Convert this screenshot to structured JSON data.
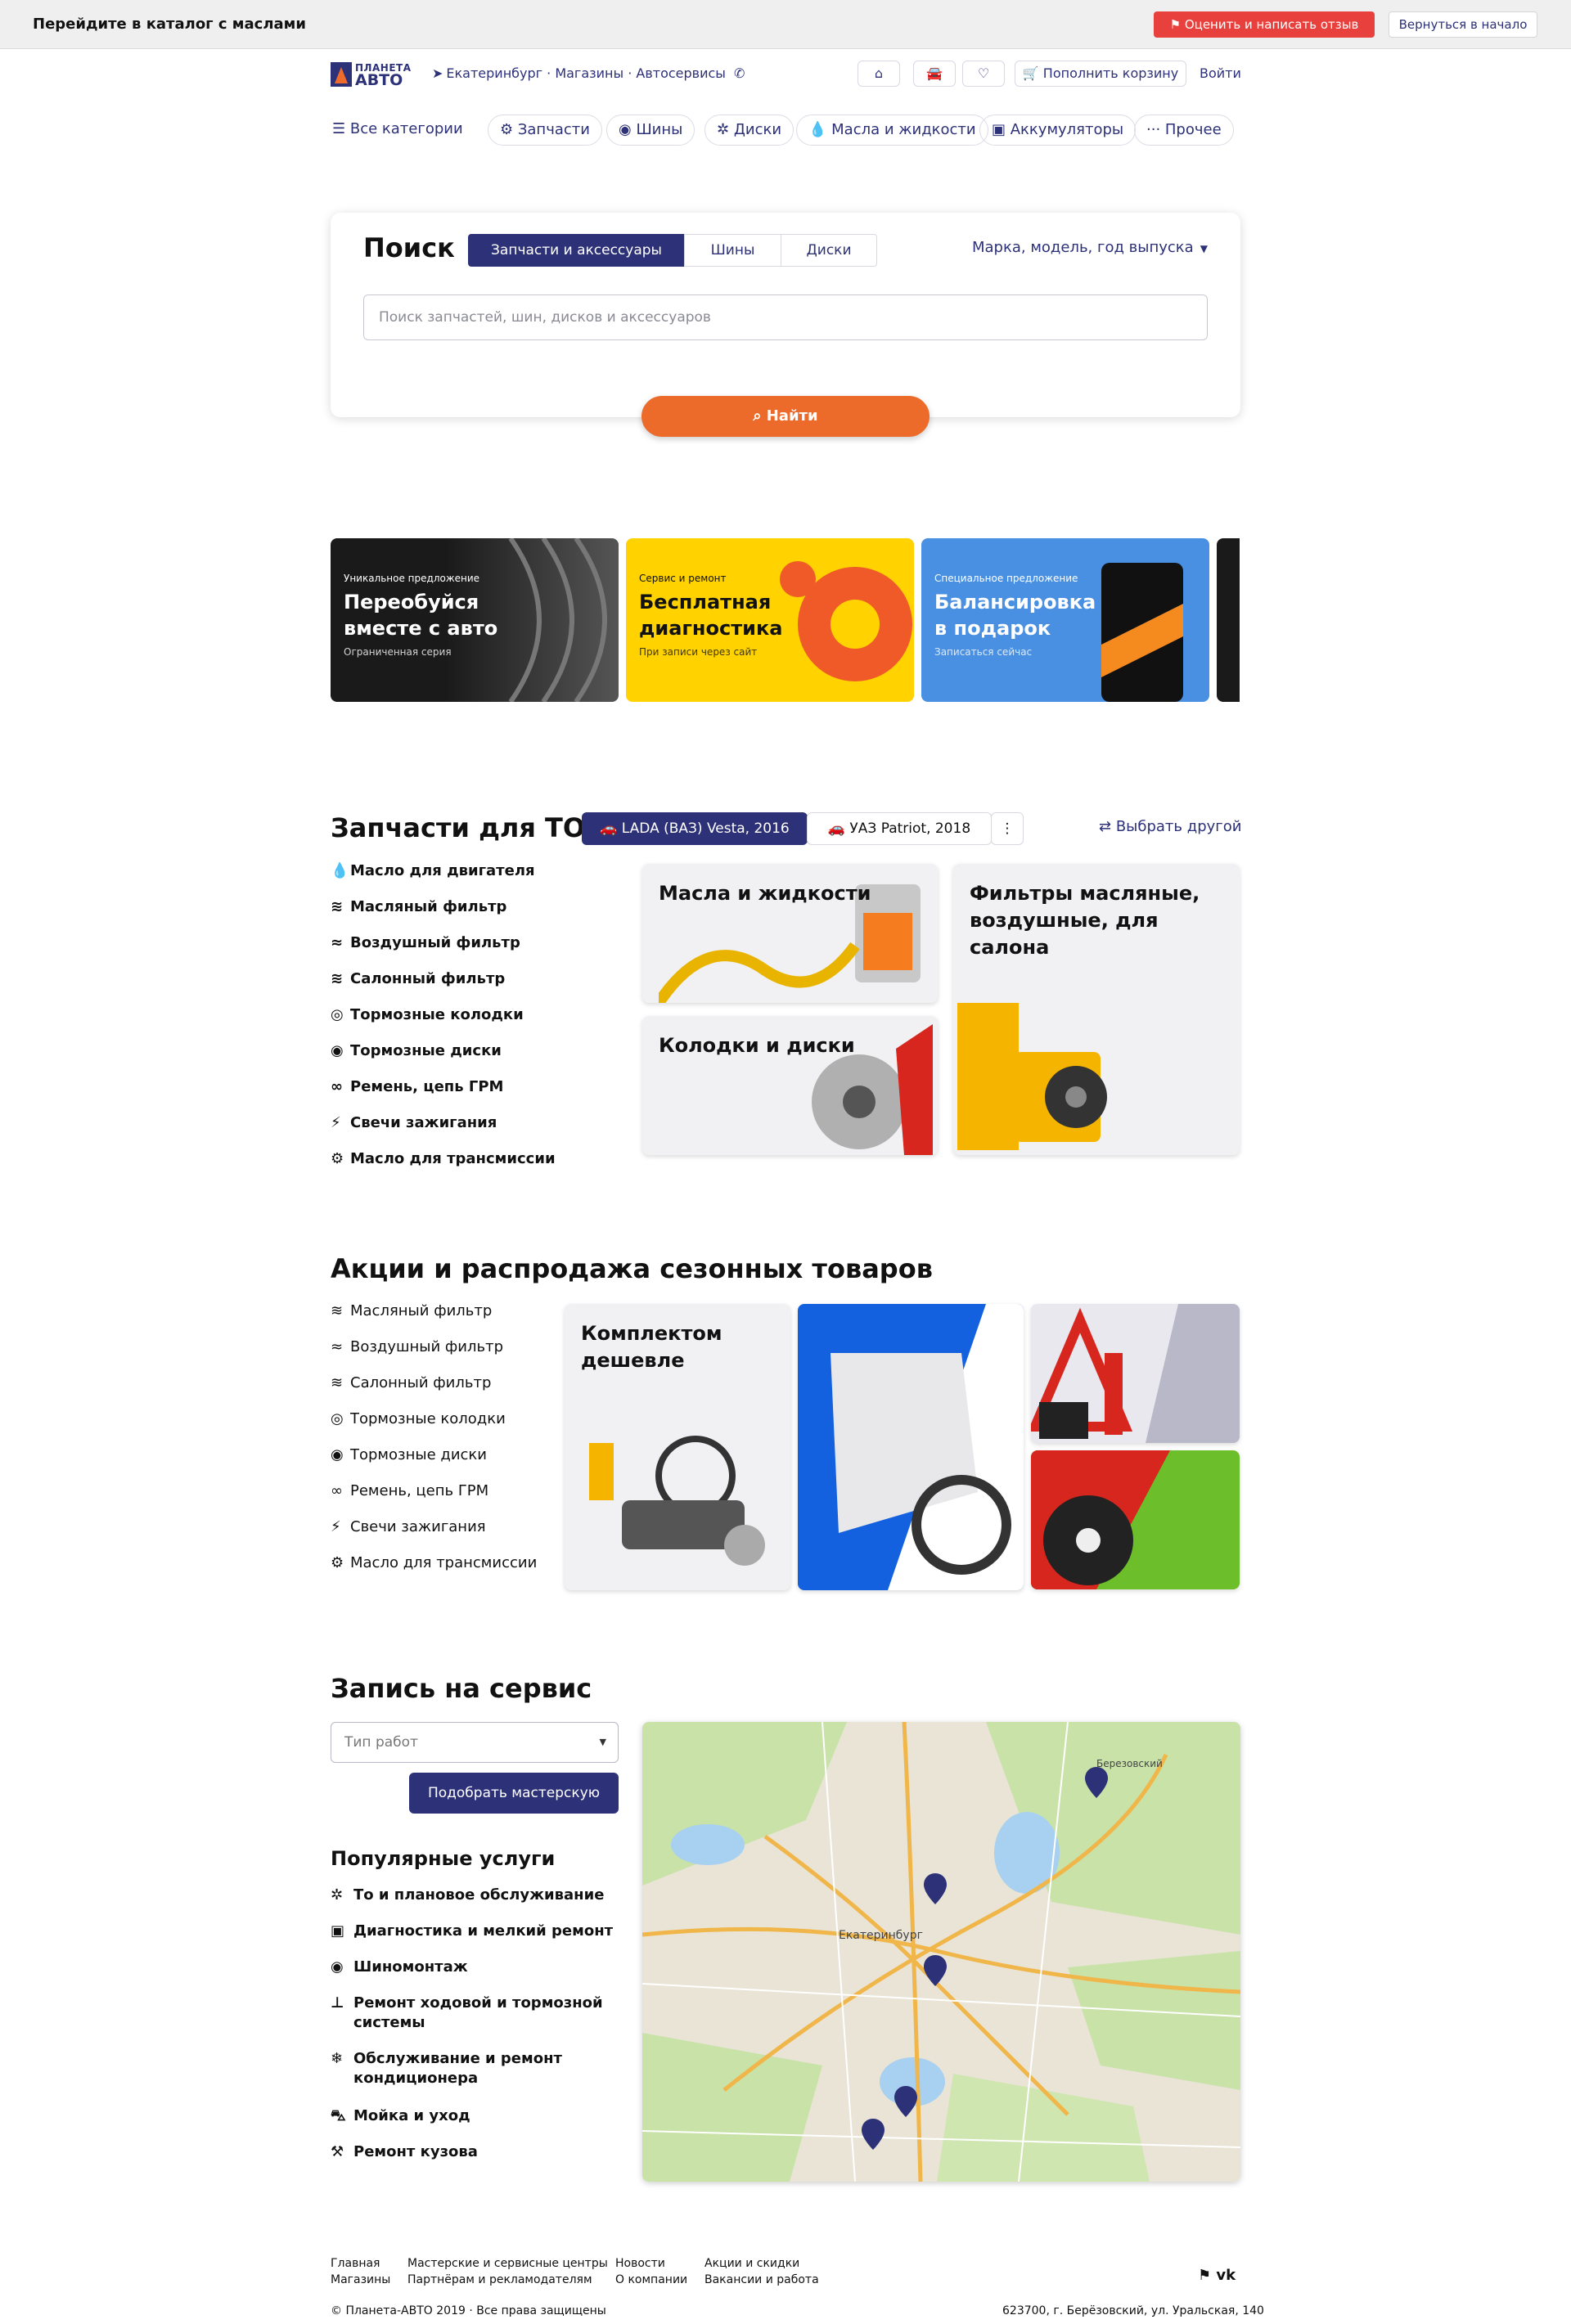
{
  "topbar": {
    "title": "Перейдите в каталог с маслами",
    "review": "Оценить и написать отзыв",
    "back": "Вернуться в начало"
  },
  "header": {
    "logo_top": "ПЛАНЕТА",
    "logo_bottom": "АВТО",
    "links": "Екатеринбург · Магазины · Автосервисы",
    "cart": "Пополнить корзину",
    "login": "Войти"
  },
  "categories": {
    "all": "Все категории",
    "items": [
      "Запчасти",
      "Шины",
      "Диски",
      "Масла и жидкости",
      "Аккумуляторы",
      "Прочее"
    ]
  },
  "search": {
    "title": "Поиск",
    "tabs": [
      "Запчасти и аксессуары",
      "Шины",
      "Диски"
    ],
    "vehicle": "Марка, модель, год выпуска",
    "placeholder": "Поиск запчастей, шин, дисков и аксессуаров",
    "button": "Найти"
  },
  "banners": [
    {
      "small": "Уникальное предложение",
      "big": "Переобуйся вместе с авто",
      "foot": "Ограниченная серия",
      "bg": "#2a2a2a"
    },
    {
      "small": "Сервис и ремонт",
      "big": "Бесплатная диагностика",
      "foot": "При записи через сайт",
      "bg": "#ffd200"
    },
    {
      "small": "Специальное предложение",
      "big": "Балансировка в подарок",
      "foot": "Записаться сейчас",
      "bg": "#4a90e2"
    }
  ],
  "to": {
    "title": "Запчасти для ТО",
    "cars": [
      "LADA (ВАЗ) Vesta, 2016",
      "УАЗ Patriot, 2018"
    ],
    "other": "Выбрать другой",
    "list": [
      "Масло для двигателя",
      "Масляный фильтр",
      "Воздушный фильтр",
      "Салонный фильтр",
      "Тормозные колодки",
      "Тормозные диски",
      "Ремень, цепь ГРМ",
      "Свечи зажигания",
      "Масло для трансмиссии"
    ],
    "cards": [
      "Масла и жидкости",
      "Фильтры масляные, воздушные, для салона",
      "Колодки и диски"
    ]
  },
  "sale": {
    "title": "Акции и распродажа сезонных товаров",
    "list": [
      "Масляный фильтр",
      "Воздушный фильтр",
      "Салонный фильтр",
      "Тормозные колодки",
      "Тормозные диски",
      "Ремень, цепь ГРМ",
      "Свечи зажигания",
      "Масло для трансмиссии"
    ],
    "card": "Комплектом дешевле"
  },
  "service": {
    "title": "Запись на сервис",
    "type": "Тип работ",
    "pick": "Подобрать мастерскую",
    "popular": "Популярные услуги",
    "items": [
      "То и плановое обслуживание",
      "Диагностика и мелкий ремонт",
      "Шиномонтаж",
      "Ремонт ходовой и тормозной системы",
      "Обслуживание и ремонт кондиционера",
      "Мойка и уход",
      "Ремонт кузова"
    ]
  },
  "map": {
    "city": "Екатеринбург",
    "town": "Березовский"
  },
  "footer": {
    "cols": [
      [
        "Главная",
        "Магазины"
      ],
      [
        "Мастерские и сервисные центры",
        "Партнёрам и рекламодателям"
      ],
      [
        "Новости",
        "О компании"
      ],
      [
        "Акции и скидки",
        "Вакансии и работа"
      ]
    ],
    "copyright": "© Планета-АВТО 2019 · Все права защищены",
    "address": "623700, г. Берёзовский, ул. Уральская, 140"
  }
}
